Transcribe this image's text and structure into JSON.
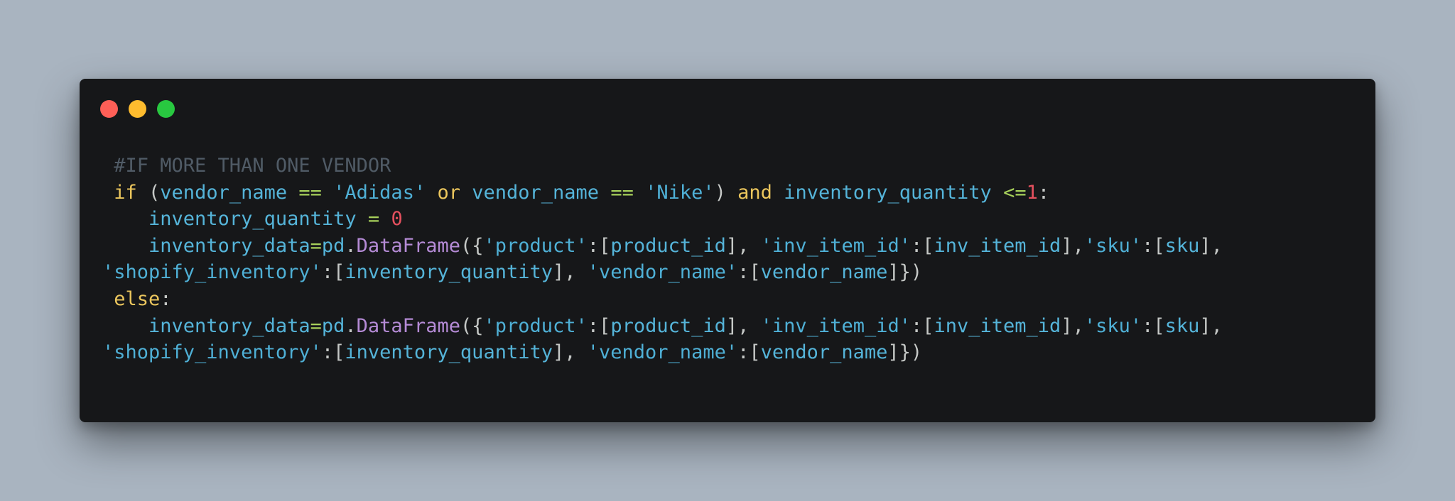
{
  "window": {
    "controls": [
      {
        "name": "close",
        "color": "#ff5f57"
      },
      {
        "name": "minimize",
        "color": "#febc2e"
      },
      {
        "name": "maximize",
        "color": "#28c840"
      }
    ]
  },
  "colors": {
    "background": "#a9b4c0",
    "editor": "#161719",
    "comment": "#505b66",
    "keyword": "#ebc65d",
    "name": "#55b4d9",
    "operator": "#a8d15b",
    "string": "#4fb0d6",
    "number": "#e4505e",
    "function": "#b58bd6",
    "punctuation": "#c5c8c6"
  },
  "code": {
    "lines": [
      {
        "id": "comment",
        "tokens": [
          {
            "t": " #IF MORE THAN ONE VENDOR",
            "k": "comment"
          }
        ]
      },
      {
        "id": "if-statement",
        "tokens": [
          {
            "t": " ",
            "k": "punct"
          },
          {
            "t": "if",
            "k": "keyword"
          },
          {
            "t": " (",
            "k": "punct"
          },
          {
            "t": "vendor_name",
            "k": "name"
          },
          {
            "t": " ",
            "k": "punct"
          },
          {
            "t": "==",
            "k": "op"
          },
          {
            "t": " ",
            "k": "punct"
          },
          {
            "t": "'Adidas'",
            "k": "string"
          },
          {
            "t": " ",
            "k": "punct"
          },
          {
            "t": "or",
            "k": "keyword"
          },
          {
            "t": " ",
            "k": "punct"
          },
          {
            "t": "vendor_name",
            "k": "name"
          },
          {
            "t": " ",
            "k": "punct"
          },
          {
            "t": "==",
            "k": "op"
          },
          {
            "t": " ",
            "k": "punct"
          },
          {
            "t": "'Nike'",
            "k": "string"
          },
          {
            "t": ") ",
            "k": "punct"
          },
          {
            "t": "and",
            "k": "keyword"
          },
          {
            "t": " ",
            "k": "punct"
          },
          {
            "t": "inventory_quantity",
            "k": "name"
          },
          {
            "t": " ",
            "k": "punct"
          },
          {
            "t": "<=",
            "k": "op"
          },
          {
            "t": "1",
            "k": "number"
          },
          {
            "t": ":",
            "k": "punct"
          }
        ]
      },
      {
        "id": "assign-zero",
        "tokens": [
          {
            "t": "    ",
            "k": "punct"
          },
          {
            "t": "inventory_quantity",
            "k": "name"
          },
          {
            "t": " ",
            "k": "punct"
          },
          {
            "t": "=",
            "k": "op"
          },
          {
            "t": " ",
            "k": "punct"
          },
          {
            "t": "0",
            "k": "number"
          }
        ]
      },
      {
        "id": "dataframe-1a",
        "tokens": [
          {
            "t": "    ",
            "k": "punct"
          },
          {
            "t": "inventory_data",
            "k": "name"
          },
          {
            "t": "=",
            "k": "op"
          },
          {
            "t": "pd",
            "k": "name"
          },
          {
            "t": ".",
            "k": "punct"
          },
          {
            "t": "DataFrame",
            "k": "func"
          },
          {
            "t": "({",
            "k": "punct"
          },
          {
            "t": "'product'",
            "k": "string"
          },
          {
            "t": ":[",
            "k": "punct"
          },
          {
            "t": "product_id",
            "k": "name"
          },
          {
            "t": "], ",
            "k": "punct"
          },
          {
            "t": "'inv_item_id'",
            "k": "string"
          },
          {
            "t": ":[",
            "k": "punct"
          },
          {
            "t": "inv_item_id",
            "k": "name"
          },
          {
            "t": "],",
            "k": "punct"
          },
          {
            "t": "'sku'",
            "k": "string"
          },
          {
            "t": ":[",
            "k": "punct"
          },
          {
            "t": "sku",
            "k": "name"
          },
          {
            "t": "],",
            "k": "punct"
          }
        ]
      },
      {
        "id": "dataframe-1b",
        "tokens": [
          {
            "t": "'shopify_inventory'",
            "k": "string"
          },
          {
            "t": ":[",
            "k": "punct"
          },
          {
            "t": "inventory_quantity",
            "k": "name"
          },
          {
            "t": "], ",
            "k": "punct"
          },
          {
            "t": "'vendor_name'",
            "k": "string"
          },
          {
            "t": ":[",
            "k": "punct"
          },
          {
            "t": "vendor_name",
            "k": "name"
          },
          {
            "t": "]})",
            "k": "punct"
          }
        ]
      },
      {
        "id": "else-statement",
        "tokens": [
          {
            "t": " ",
            "k": "punct"
          },
          {
            "t": "else",
            "k": "keyword"
          },
          {
            "t": ":",
            "k": "punct"
          }
        ]
      },
      {
        "id": "dataframe-2a",
        "tokens": [
          {
            "t": "    ",
            "k": "punct"
          },
          {
            "t": "inventory_data",
            "k": "name"
          },
          {
            "t": "=",
            "k": "op"
          },
          {
            "t": "pd",
            "k": "name"
          },
          {
            "t": ".",
            "k": "punct"
          },
          {
            "t": "DataFrame",
            "k": "func"
          },
          {
            "t": "({",
            "k": "punct"
          },
          {
            "t": "'product'",
            "k": "string"
          },
          {
            "t": ":[",
            "k": "punct"
          },
          {
            "t": "product_id",
            "k": "name"
          },
          {
            "t": "], ",
            "k": "punct"
          },
          {
            "t": "'inv_item_id'",
            "k": "string"
          },
          {
            "t": ":[",
            "k": "punct"
          },
          {
            "t": "inv_item_id",
            "k": "name"
          },
          {
            "t": "],",
            "k": "punct"
          },
          {
            "t": "'sku'",
            "k": "string"
          },
          {
            "t": ":[",
            "k": "punct"
          },
          {
            "t": "sku",
            "k": "name"
          },
          {
            "t": "],",
            "k": "punct"
          }
        ]
      },
      {
        "id": "dataframe-2b",
        "tokens": [
          {
            "t": "'shopify_inventory'",
            "k": "string"
          },
          {
            "t": ":[",
            "k": "punct"
          },
          {
            "t": "inventory_quantity",
            "k": "name"
          },
          {
            "t": "], ",
            "k": "punct"
          },
          {
            "t": "'vendor_name'",
            "k": "string"
          },
          {
            "t": ":[",
            "k": "punct"
          },
          {
            "t": "vendor_name",
            "k": "name"
          },
          {
            "t": "]})",
            "k": "punct"
          }
        ]
      }
    ]
  }
}
